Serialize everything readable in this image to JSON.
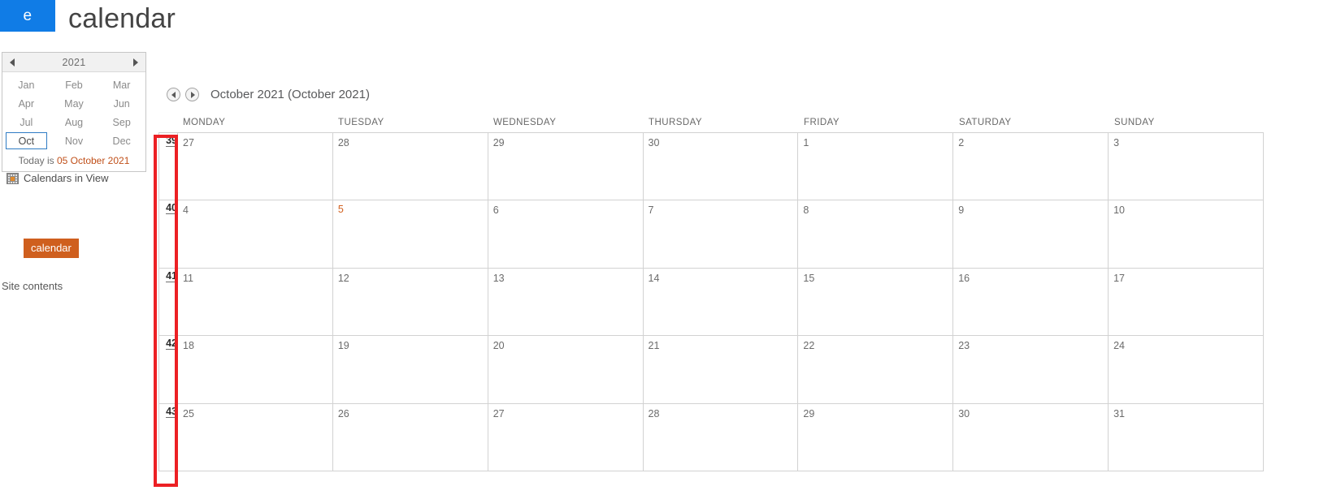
{
  "suite": {
    "app_tile_label": "e",
    "site_title": "calendar"
  },
  "sidebar": {
    "mini_calendar": {
      "prev_year_icon": "triangle-left-icon",
      "next_year_icon": "triangle-right-icon",
      "year": "2021",
      "months": [
        "Jan",
        "Feb",
        "Mar",
        "Apr",
        "May",
        "Jun",
        "Jul",
        "Aug",
        "Sep",
        "Oct",
        "Nov",
        "Dec"
      ],
      "selected_month": "Oct",
      "today_prefix": "Today is ",
      "today_date": "05 October 2021",
      "selection_border_color": "#2f7cc4",
      "today_date_color": "#c0501a"
    },
    "calendars_in_view": {
      "icon": "calendar-grid-icon",
      "label": "Calendars in View",
      "chip_label": "calendar",
      "chip_color": "#cf5f1e"
    },
    "site_contents_label": "Site contents"
  },
  "calendar": {
    "prev_icon": "circle-arrow-left-icon",
    "next_icon": "circle-arrow-right-icon",
    "period_title": "October 2021 (October 2021)",
    "weekdays": [
      "MONDAY",
      "TUESDAY",
      "WEDNESDAY",
      "THURSDAY",
      "FRIDAY",
      "SATURDAY",
      "SUNDAY"
    ],
    "week_numbers": [
      "39",
      "40",
      "41",
      "42",
      "43"
    ],
    "weeks": [
      {
        "week": "39",
        "days": [
          {
            "num": "27",
            "today": false
          },
          {
            "num": "28",
            "today": false
          },
          {
            "num": "29",
            "today": false
          },
          {
            "num": "30",
            "today": false
          },
          {
            "num": "1",
            "today": false
          },
          {
            "num": "2",
            "today": false
          },
          {
            "num": "3",
            "today": false
          }
        ]
      },
      {
        "week": "40",
        "days": [
          {
            "num": "4",
            "today": false
          },
          {
            "num": "5",
            "today": true
          },
          {
            "num": "6",
            "today": false
          },
          {
            "num": "7",
            "today": false
          },
          {
            "num": "8",
            "today": false
          },
          {
            "num": "9",
            "today": false
          },
          {
            "num": "10",
            "today": false
          }
        ]
      },
      {
        "week": "41",
        "days": [
          {
            "num": "11",
            "today": false
          },
          {
            "num": "12",
            "today": false
          },
          {
            "num": "13",
            "today": false
          },
          {
            "num": "14",
            "today": false
          },
          {
            "num": "15",
            "today": false
          },
          {
            "num": "16",
            "today": false
          },
          {
            "num": "17",
            "today": false
          }
        ]
      },
      {
        "week": "42",
        "days": [
          {
            "num": "18",
            "today": false
          },
          {
            "num": "19",
            "today": false
          },
          {
            "num": "20",
            "today": false
          },
          {
            "num": "21",
            "today": false
          },
          {
            "num": "22",
            "today": false
          },
          {
            "num": "23",
            "today": false
          },
          {
            "num": "24",
            "today": false
          }
        ]
      },
      {
        "week": "43",
        "days": [
          {
            "num": "25",
            "today": false
          },
          {
            "num": "26",
            "today": false
          },
          {
            "num": "27",
            "today": false
          },
          {
            "num": "28",
            "today": false
          },
          {
            "num": "29",
            "today": false
          },
          {
            "num": "30",
            "today": false
          },
          {
            "num": "31",
            "today": false
          }
        ]
      }
    ],
    "today_accent_color": "#d2601f"
  },
  "annotation": {
    "shape": "rectangle",
    "color": "#ec2024",
    "targets": "week-number-column"
  }
}
